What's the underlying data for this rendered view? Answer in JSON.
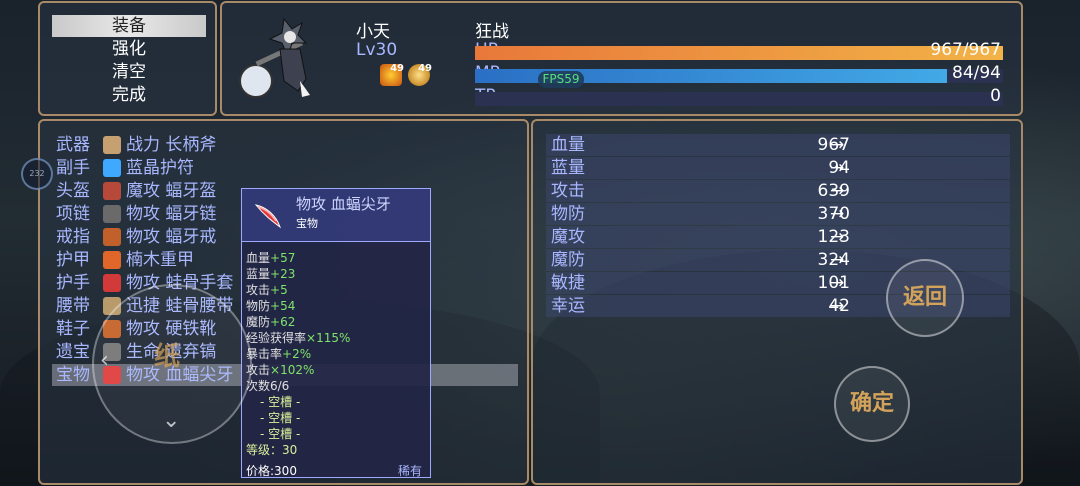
{
  "menu": {
    "items": [
      "装备",
      "强化",
      "清空",
      "完成"
    ],
    "selected_index": 0
  },
  "hero": {
    "name": "小天",
    "level": "Lv30",
    "class_name": "狂战",
    "buffs": [
      {
        "icon": "fire-buff-icon",
        "turns": "49"
      },
      {
        "icon": "sun-buff-icon",
        "turns": "49"
      }
    ],
    "hp": {
      "label": "HP",
      "value": "967/967",
      "fraction": 1.0
    },
    "mp": {
      "label": "MP",
      "value": "84/94",
      "fraction": 0.894
    },
    "tp": {
      "label": "TP",
      "value": "0",
      "fraction": 0.0
    },
    "fps": "FPS59"
  },
  "equipment": {
    "slots": [
      {
        "slot": "武器",
        "item": "战力 长柄斧",
        "icon": "axe-icon",
        "color": "#c6a070"
      },
      {
        "slot": "副手",
        "item": "蓝晶护符",
        "icon": "crystal-icon",
        "color": "#3fa8ff"
      },
      {
        "slot": "头盔",
        "item": "魔攻 蝠牙盔",
        "icon": "helmet-icon",
        "color": "#b7493a"
      },
      {
        "slot": "项链",
        "item": "物攻 蝠牙链",
        "icon": "necklace-icon",
        "color": "#6a6a6a"
      },
      {
        "slot": "戒指",
        "item": "物攻 蝠牙戒",
        "icon": "ring-icon",
        "color": "#c2602c"
      },
      {
        "slot": "护甲",
        "item": "楠木重甲",
        "icon": "armor-icon",
        "color": "#e0662a"
      },
      {
        "slot": "护手",
        "item": "物攻 蛙骨手套",
        "icon": "glove-icon",
        "color": "#d23a3a"
      },
      {
        "slot": "腰带",
        "item": "迅捷 蛙骨腰带",
        "icon": "belt-icon",
        "color": "#b99a6a"
      },
      {
        "slot": "鞋子",
        "item": "物攻 硬铁靴",
        "icon": "boots-icon",
        "color": "#c5622a"
      },
      {
        "slot": "遗宝",
        "item": "生命 遗弃镐",
        "icon": "pickaxe-icon",
        "color": "#777777"
      },
      {
        "slot": "宝物",
        "item": "物攻 血蝠尖牙",
        "icon": "fang-icon",
        "color": "#e04040"
      }
    ],
    "selected_index": 10
  },
  "tooltip": {
    "title": "物攻 血蝠尖牙",
    "type": "宝物",
    "lines": [
      {
        "label": "血量",
        "value": "+57"
      },
      {
        "label": "蓝量",
        "value": "+23"
      },
      {
        "label": "攻击",
        "value": "+5"
      },
      {
        "label": "物防",
        "value": "+54"
      },
      {
        "label": "魔防",
        "value": "+62"
      },
      {
        "label": "经验获得率",
        "value": "×115%"
      },
      {
        "label": "暴击率",
        "value": "+2%"
      },
      {
        "label": "攻击",
        "value": "×102%"
      }
    ],
    "uses": "次数6/6",
    "slots": [
      "- 空槽 -",
      "- 空槽 -",
      "- 空槽 -"
    ],
    "level": "等级：30",
    "price": "价格:300",
    "rarity": "稀有"
  },
  "stats": [
    {
      "label": "血量",
      "value": "967",
      "arrow": "→"
    },
    {
      "label": "蓝量",
      "value": "94",
      "arrow": "→"
    },
    {
      "label": "攻击",
      "value": "639",
      "arrow": "→"
    },
    {
      "label": "物防",
      "value": "370",
      "arrow": "→"
    },
    {
      "label": "魔攻",
      "value": "123",
      "arrow": "→"
    },
    {
      "label": "魔防",
      "value": "324",
      "arrow": "→"
    },
    {
      "label": "敏捷",
      "value": "101",
      "arrow": "→"
    },
    {
      "label": "幸运",
      "value": "42",
      "arrow": "→"
    }
  ],
  "buttons": {
    "back": "返回",
    "confirm": "确定",
    "dpad_label": "纸"
  },
  "side_indicator": "232",
  "colors": {
    "hp": "#f2b347",
    "mp": "#42a9e6",
    "border": "#a98a68",
    "accent_text": "#a9b7ff"
  }
}
